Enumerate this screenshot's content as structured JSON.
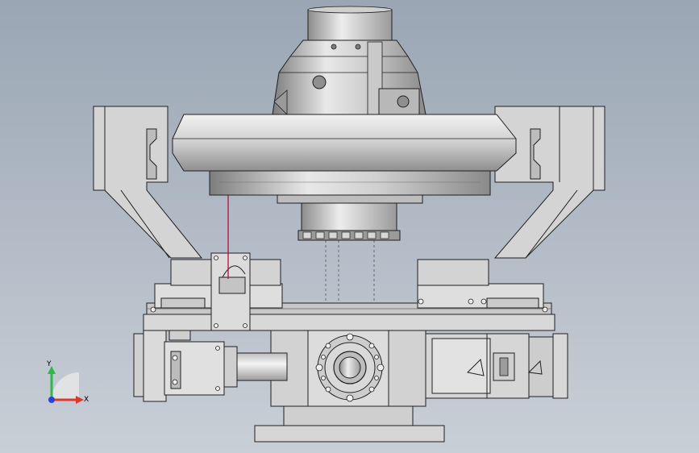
{
  "viewport": {
    "background_top": "#9aa6b4",
    "background_bottom": "#c9cfd7"
  },
  "triad": {
    "y_label": "Y",
    "x_label": "X",
    "y_color": "#2fb84a",
    "x_color": "#d93a2b",
    "z_color": "#2b3fd9"
  },
  "colors": {
    "part_fill": "#d4d4d4",
    "part_light": "#e6e6e6",
    "part_dark": "#a8a8a8",
    "edge": "#1f1f1f",
    "sensor_beam": "#b0123a"
  },
  "icons": [
    "coordinate-triad-icon"
  ]
}
